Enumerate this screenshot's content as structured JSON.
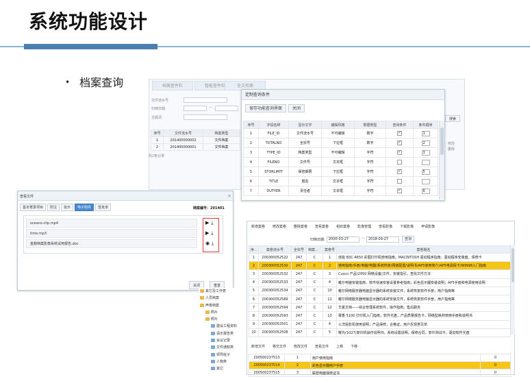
{
  "slide": {
    "title": "系统功能设计",
    "bullet_mark": "•",
    "bullet": "档案查询"
  },
  "query_panel": {
    "tabs": [
      "档案查件栏",
      "智能查件栏",
      "全文检索"
    ],
    "fields": [
      {
        "label": "文件流水号"
      },
      {
        "label": "归档日期"
      },
      {
        "label": "主题词"
      }
    ],
    "date_sep": "—",
    "columns": [
      "序号",
      "文件流水号",
      "档案类型"
    ],
    "rows": [
      [
        "1",
        "201400000002",
        "文件档案"
      ],
      [
        "2",
        "201400000001",
        "文件档案"
      ]
    ],
    "footer": "共2条记录",
    "right_btn": "搜索",
    "right_labels": [
      "修改",
      "删除"
    ]
  },
  "config_dialog": {
    "title": "定制查询条件",
    "save_label": "保存功能查询界面",
    "close_label": "关闭",
    "columns": [
      "序号",
      "字段名称",
      "显示文字",
      "编辑风格",
      "数据类型",
      "查询条件",
      "条件顺序"
    ],
    "rows": [
      [
        "1",
        "FILE_ID",
        "文件流水号",
        "不可编辑",
        "数字",
        true,
        "1"
      ],
      [
        "2",
        "TOTALNO",
        "全宗号",
        "下拉框",
        "数字",
        true,
        "2"
      ],
      [
        "3",
        "TYPE_ID",
        "档案类型",
        "不可编辑",
        "字符",
        true,
        "3"
      ],
      [
        "4",
        "FILENO",
        "文件号",
        "文本框",
        "字符",
        false,
        ""
      ],
      [
        "5",
        "STORLIMIT",
        "保管期限",
        "下拉框",
        "字符",
        true,
        "5"
      ],
      [
        "6",
        "TITLE",
        "题名",
        "文本框",
        "字符",
        false,
        ""
      ],
      [
        "7",
        "DUTYER",
        "责任者",
        "文本框",
        "字符",
        true,
        "6"
      ]
    ]
  },
  "view_dialog": {
    "title": "查看文件",
    "close_x": "×",
    "tabs": [
      "基本著录项目",
      "附注",
      "批示",
      "电子附件",
      "签批单"
    ],
    "code_label": "档案编号：201401",
    "files": [
      "oceans-clip.mp4",
      "time.mp3",
      "金税档案影像系统试用报告.doc"
    ],
    "footer_buttons": [
      "关闭",
      "重置"
    ]
  },
  "tree": {
    "items": [
      "其它及工作表",
      "人员档案",
      "声像档案",
      "照片",
      "照片",
      "建设工程资料",
      "请示报告类",
      "会议记录",
      "文件通知类",
      "领导班子",
      "人物类",
      "其它"
    ]
  },
  "bottom_panel": {
    "toolbar": [
      "新增案卷",
      "修改案卷",
      "删除案卷",
      "查看案卷",
      "组织案卷",
      "影像管理",
      "查看影像",
      "下载影像",
      "申请影像"
    ],
    "search_label": "归档日期:",
    "date_from": "2000-03-27",
    "date_to": "2018-09-27",
    "search_btn": "查询",
    "columns": [
      "序号",
      "案卷流水号",
      "全宗号",
      "档案类型",
      "案卷号",
      "案卷题名"
    ],
    "rows": [
      [
        "1",
        "200300052522",
        "247",
        "C",
        "1",
        "佳能 B3C-4650 彩图打印机使用指南，MACINTOSH 驱动程序指南，驱动程序安装盘，保修卡"
      ],
      [
        "2",
        "200300052530",
        "247",
        "C",
        "2",
        "使用指南/手册/电脑/电器/系统恢复/网络配置/说明书/AP5使用简介/AP5电源保卡/WIN98入门指南"
      ],
      [
        "3",
        "200300052532",
        "247",
        "C",
        "3",
        "Cusco 产品(2950 网络设备)文件，安装指引，查找文件方法"
      ],
      [
        "4",
        "200300052533",
        "247",
        "C",
        "4",
        "戴尔电脑安装指南，软件快速安装设置参考指南；彩色显示器安装说明；AP5手册和电源使用说明"
      ],
      [
        "5",
        "200300052534",
        "247",
        "C",
        "10",
        "戴尔网络服务器电脑显示器的系统安装文件，系统恢复软件手册，用户指南等"
      ],
      [
        "6",
        "200300052589",
        "247",
        "C",
        "11",
        "戴尔网络服务器电脑显示器的系统安装文件，系统恢复软件手册，用户指南等"
      ],
      [
        "7",
        "200300052594",
        "247",
        "C",
        "12",
        "华夏文档——综合管理系统软件，操作指南，售后服务"
      ],
      [
        "8",
        "200300052593",
        "247",
        "C",
        "13",
        "赛香 5100 打印机入门指南，软件光盘，产品质量报告卡，网络型耗材使用手册和说明书"
      ],
      [
        "9",
        "200300052501",
        "247",
        "C",
        "4",
        "三洋投影机使用说明，产品保修，合格证，用户反馈意见单"
      ],
      [
        "10",
        "200300052508",
        "247",
        "C",
        "5",
        "樱光(1027)复印机操作说明书，系统设置说明，保修合同，复印测试卡，驱动软件光盘"
      ]
    ],
    "lower_toolbar": [
      "新增文件",
      "移交文件",
      "修改文件",
      "查看文件",
      "上移",
      "下移"
    ],
    "lower_rows": [
      [
        "200500237513",
        "1",
        "用户使用指南",
        "0"
      ],
      [
        "200500237514",
        "2",
        "彩色显示器用户手册",
        "0"
      ],
      [
        "200500237515",
        "3",
        "联想电脑保修证书",
        "0"
      ]
    ]
  }
}
